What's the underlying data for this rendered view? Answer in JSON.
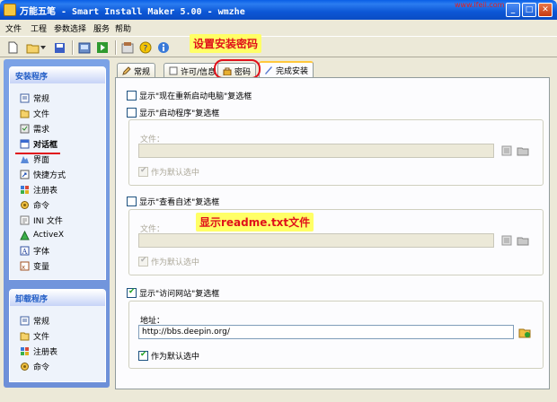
{
  "window": {
    "title": "万能五笔 - Smart Install Maker 5.00 - wmzhe",
    "watermark": "www.ifeii.com",
    "buttons": {
      "minimize": "_",
      "maximize": "□",
      "close": "✕"
    }
  },
  "menu": [
    "文件",
    "工程",
    "参数选择",
    "服务",
    "帮助"
  ],
  "annotations": {
    "top": "设置安装密码",
    "middle": "显示readme.txt文件"
  },
  "sidebar": {
    "install_title": "安装程序",
    "install_items": [
      {
        "label": "常规",
        "icon": "general-icon"
      },
      {
        "label": "文件",
        "icon": "files-icon"
      },
      {
        "label": "需求",
        "icon": "requirements-icon"
      },
      {
        "label": "对话框",
        "icon": "dialogs-icon"
      },
      {
        "label": "界面",
        "icon": "interface-icon"
      },
      {
        "label": "快捷方式",
        "icon": "shortcut-icon"
      },
      {
        "label": "注册表",
        "icon": "registry-icon"
      },
      {
        "label": "命令",
        "icon": "command-icon"
      },
      {
        "label": "INI 文件",
        "icon": "ini-icon"
      },
      {
        "label": "ActiveX",
        "icon": "activex-icon"
      },
      {
        "label": "字体",
        "icon": "font-icon"
      },
      {
        "label": "变量",
        "icon": "variable-icon"
      }
    ],
    "uninstall_title": "卸载程序",
    "uninstall_items": [
      {
        "label": "常规",
        "icon": "general-icon"
      },
      {
        "label": "文件",
        "icon": "files-icon"
      },
      {
        "label": "注册表",
        "icon": "registry-icon"
      },
      {
        "label": "命令",
        "icon": "command-icon"
      }
    ]
  },
  "tabs": [
    {
      "label": "常规",
      "icon": "pencil-icon"
    },
    {
      "label": "许可/信息",
      "icon": "document-icon"
    },
    {
      "label": "密码",
      "icon": "lock-icon"
    },
    {
      "label": "完成安装",
      "icon": "finish-icon"
    }
  ],
  "content": {
    "restart": {
      "label": "显示\"现在重新启动电脑\"复选框",
      "checked": false
    },
    "launch": {
      "label": "显示\"启动程序\"复选框",
      "checked": false,
      "file_label": "文件：",
      "file_value": "",
      "default_label": "作为默认选中",
      "default_checked": true
    },
    "readme": {
      "label": "显示\"查看自述\"复选框",
      "checked": false,
      "file_label": "文件：",
      "file_value": "",
      "default_label": "作为默认选中",
      "default_checked": true
    },
    "website": {
      "label": "显示\"访问网站\"复选框",
      "checked": true,
      "address_label": "地址：",
      "address_value": "http://bbs.deepin.org/",
      "default_label": "作为默认选中",
      "default_checked": true
    }
  },
  "colors": {
    "accent": "#215dc6",
    "annotation_text": "#e0101a",
    "annotation_bg": "#ffff66"
  }
}
